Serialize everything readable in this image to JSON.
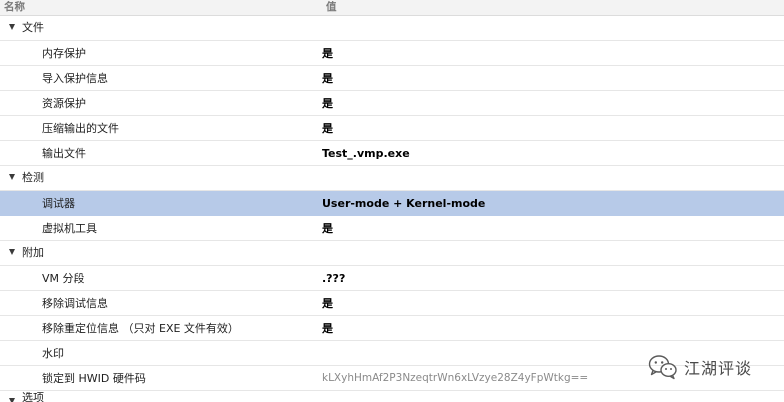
{
  "header": {
    "name_label": "名称",
    "value_label": "值"
  },
  "rows": [
    {
      "kind": "category",
      "label": "文件"
    },
    {
      "kind": "property",
      "name": "内存保护",
      "value": "是"
    },
    {
      "kind": "property",
      "name": "导入保护信息",
      "value": "是"
    },
    {
      "kind": "property",
      "name": "资源保护",
      "value": "是"
    },
    {
      "kind": "property",
      "name": "压缩输出的文件",
      "value": "是"
    },
    {
      "kind": "property",
      "name": "输出文件",
      "value": "Test_.vmp.exe"
    },
    {
      "kind": "category",
      "label": "检测"
    },
    {
      "kind": "property",
      "name": "调试器",
      "value": "User-mode + Kernel-mode",
      "selected": true
    },
    {
      "kind": "property",
      "name": "虚拟机工具",
      "value": "是"
    },
    {
      "kind": "category",
      "label": "附加"
    },
    {
      "kind": "property",
      "name": "VM 分段",
      "value": ".???"
    },
    {
      "kind": "property",
      "name": "移除调试信息",
      "value": "是"
    },
    {
      "kind": "property",
      "name": "移除重定位信息 （只对 EXE 文件有效）",
      "value": "是"
    },
    {
      "kind": "property",
      "name": "水印",
      "value": ""
    },
    {
      "kind": "property",
      "name": "锁定到 HWID 硬件码",
      "value": "kLXyhHmAf2P3NzeqtrWn6xLVzye28Z4yFpWtkg==",
      "muted": true
    },
    {
      "kind": "category",
      "label": "选项"
    }
  ],
  "watermark": {
    "icon": "wechat-icon",
    "text": "江湖评谈"
  },
  "colors": {
    "selection": "#b7cae8",
    "header_bg": "#f3f3f3",
    "row_divider": "#e6e6e6"
  }
}
